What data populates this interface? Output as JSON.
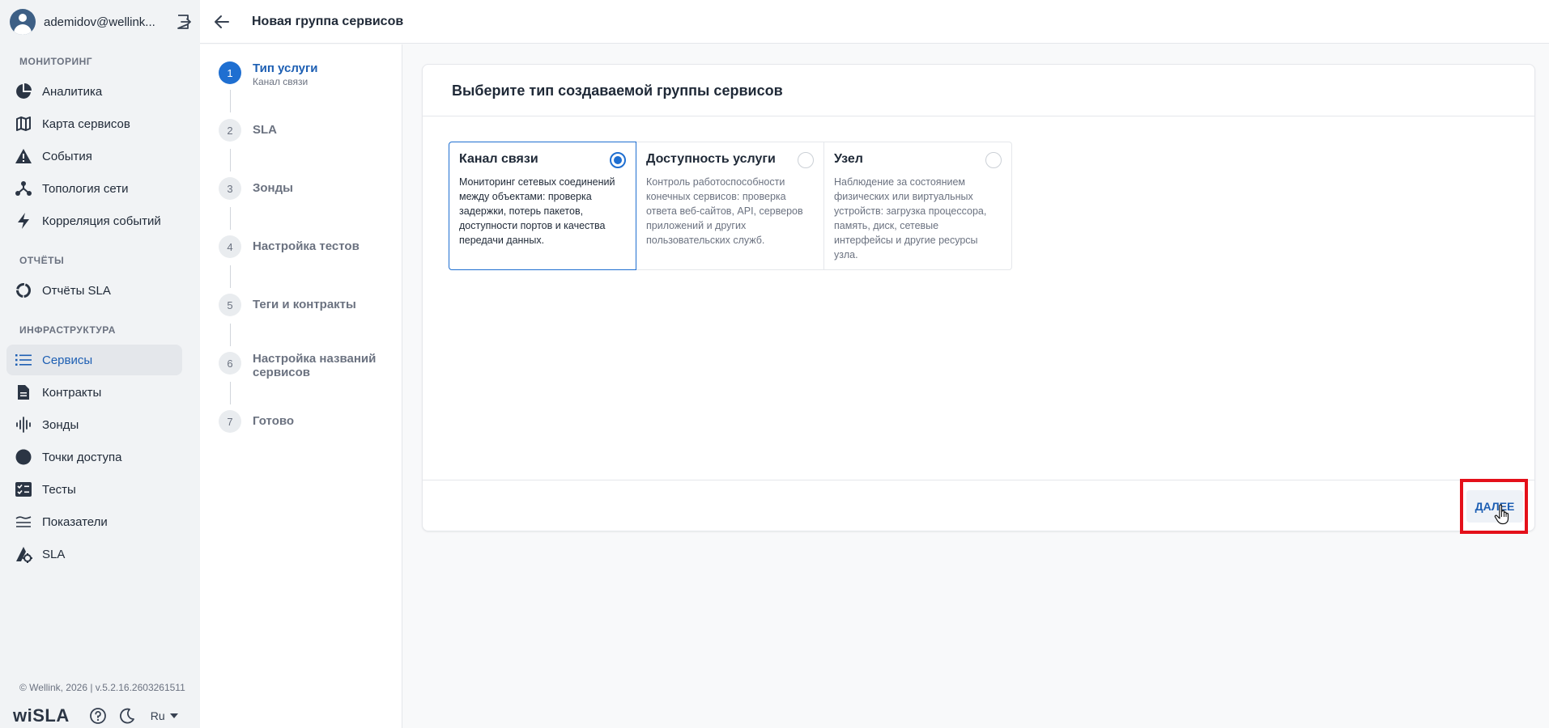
{
  "user": {
    "name": "ademidov@wellink..."
  },
  "sidebar": {
    "sections": [
      {
        "title": "МОНИТОРИНГ",
        "items": [
          {
            "label": "Аналитика",
            "icon": "pie-chart-icon"
          },
          {
            "label": "Карта сервисов",
            "icon": "map-icon"
          },
          {
            "label": "События",
            "icon": "warning-icon"
          },
          {
            "label": "Топология сети",
            "icon": "topology-icon"
          },
          {
            "label": "Корреляция событий",
            "icon": "lightning-icon"
          }
        ]
      },
      {
        "title": "ОТЧЁТЫ",
        "items": [
          {
            "label": "Отчёты SLA",
            "icon": "donut-icon"
          }
        ]
      },
      {
        "title": "ИНФРАСТРУКТУРА",
        "items": [
          {
            "label": "Сервисы",
            "icon": "list-icon",
            "active": true
          },
          {
            "label": "Контракты",
            "icon": "document-icon"
          },
          {
            "label": "Зонды",
            "icon": "waveform-icon"
          },
          {
            "label": "Точки доступа",
            "icon": "circle-icon"
          },
          {
            "label": "Тесты",
            "icon": "checklist-icon"
          },
          {
            "label": "Показатели",
            "icon": "metrics-icon"
          },
          {
            "label": "SLA",
            "icon": "sla-icon"
          }
        ]
      }
    ],
    "copyright": "© Wellink, 2026 | v.5.2.16.2603261511",
    "brand": "wiSLA",
    "language": "Ru"
  },
  "header": {
    "title": "Новая группа сервисов"
  },
  "stepper": {
    "steps": [
      {
        "num": "1",
        "label": "Тип услуги",
        "sub": "Канал связи",
        "active": true
      },
      {
        "num": "2",
        "label": "SLA"
      },
      {
        "num": "3",
        "label": "Зонды"
      },
      {
        "num": "4",
        "label": "Настройка тестов"
      },
      {
        "num": "5",
        "label": "Теги и контракты"
      },
      {
        "num": "6",
        "label": "Настройка названий сервисов"
      },
      {
        "num": "7",
        "label": "Готово"
      }
    ]
  },
  "main": {
    "title": "Выберите тип создаваемой группы сервисов",
    "options": [
      {
        "title": "Канал связи",
        "desc": "Мониторинг сетевых соединений между объектами: проверка задержки, потерь пакетов, доступности портов и качества передачи данных.",
        "selected": true
      },
      {
        "title": "Доступность услуги",
        "desc": "Контроль работоспособности конечных сервисов: проверка ответа веб-сайтов, API, серверов приложений и других пользовательских служб.",
        "selected": false
      },
      {
        "title": "Узел",
        "desc": "Наблюдение за состоянием физических или виртуальных устройств: загрузка процессора, память, диск, сетевые интерфейсы и другие ресурсы узла.",
        "selected": false
      }
    ],
    "next_label": "ДАЛЕЕ"
  },
  "colors": {
    "accent": "#1f6fd1",
    "highlight": "#e4101a"
  }
}
